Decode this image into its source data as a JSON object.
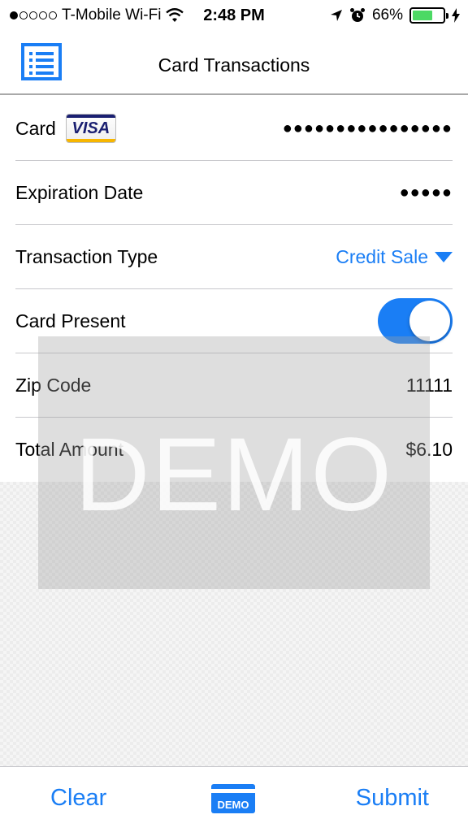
{
  "status_bar": {
    "carrier": "T-Mobile Wi-Fi",
    "time": "2:48 PM",
    "battery_percent": "66%",
    "battery_level": 0.66,
    "signal_bars_filled": 1,
    "signal_bars_total": 5
  },
  "nav": {
    "title": "Card Transactions",
    "menu_icon": "list-icon"
  },
  "form": {
    "card": {
      "label": "Card",
      "brand": "VISA",
      "value": "●●●●●●●●●●●●●●●●"
    },
    "expiration": {
      "label": "Expiration Date",
      "value": "●●●●●"
    },
    "transaction_type": {
      "label": "Transaction Type",
      "value": "Credit Sale"
    },
    "card_present": {
      "label": "Card Present",
      "on": true
    },
    "zip": {
      "label": "Zip Code",
      "value": "11111"
    },
    "total": {
      "label": "Total Amount",
      "value": "$6.10"
    }
  },
  "watermark": {
    "text": "DEMO"
  },
  "toolbar": {
    "clear_label": "Clear",
    "demo_badge": "DEMO",
    "submit_label": "Submit"
  },
  "colors": {
    "accent": "#1a7ef5",
    "battery": "#4cd964",
    "separator": "#c8c8cc"
  }
}
